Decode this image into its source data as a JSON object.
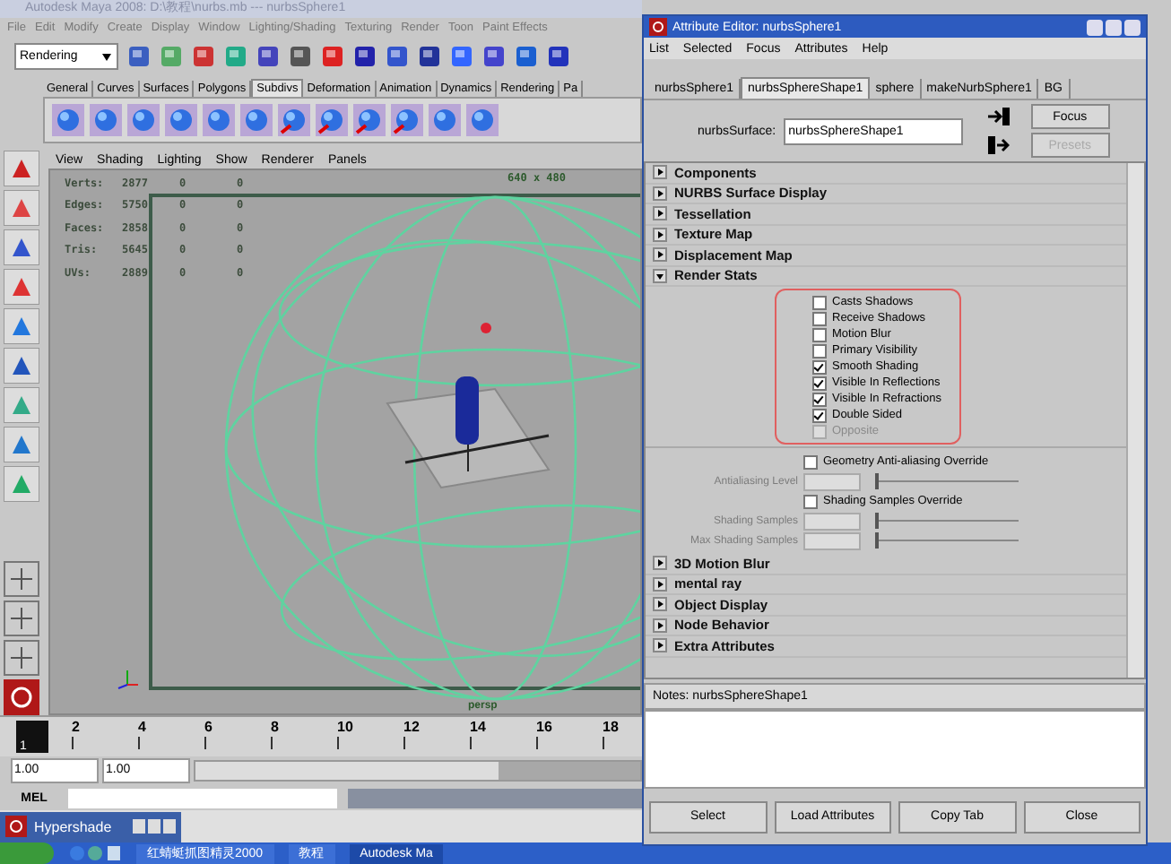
{
  "main_window": {
    "title": "Autodesk Maya 2008: D:\\教程\\nurbs.mb --- nurbsSphere1",
    "menu": [
      "File",
      "Edit",
      "Modify",
      "Create",
      "Display",
      "Window",
      "Lighting/Shading",
      "Texturing",
      "Render",
      "Toon",
      "Paint Effects"
    ],
    "menu_set": "Rendering",
    "shelf_tabs": [
      {
        "label": "General",
        "selected": false
      },
      {
        "label": "Curves",
        "selected": false
      },
      {
        "label": "Surfaces",
        "selected": false
      },
      {
        "label": "Polygons",
        "selected": false
      },
      {
        "label": "Subdivs",
        "selected": true
      },
      {
        "label": "Deformation",
        "selected": false
      },
      {
        "label": "Animation",
        "selected": false
      },
      {
        "label": "Dynamics",
        "selected": false
      },
      {
        "label": "Rendering",
        "selected": false
      },
      {
        "label": "Pa",
        "selected": false
      }
    ],
    "panel_menu": [
      "View",
      "Shading",
      "Lighting",
      "Show",
      "Renderer",
      "Panels"
    ],
    "hud": [
      {
        "label": "Verts:",
        "values": [
          "2877",
          "0",
          "0"
        ]
      },
      {
        "label": "Edges:",
        "values": [
          "5750",
          "0",
          "0"
        ]
      },
      {
        "label": "Faces:",
        "values": [
          "2858",
          "0",
          "0"
        ]
      },
      {
        "label": "Tris:",
        "values": [
          "5645",
          "0",
          "0"
        ]
      },
      {
        "label": "UVs:",
        "values": [
          "2889",
          "0",
          "0"
        ]
      }
    ],
    "resolution": "640 x 480",
    "camera": "persp",
    "timeline": {
      "current": "1",
      "level": 0,
      "ticks": [
        "2",
        "4",
        "6",
        "8",
        "10",
        "12",
        "14",
        "16",
        "18"
      ]
    },
    "range": {
      "fields": [
        "1.00",
        "1.00"
      ],
      "level": 0.68
    },
    "command_line": {
      "label": "MEL"
    },
    "minimized_window": {
      "title": "Hypershade"
    }
  },
  "taskbar": {
    "items": [
      "红蜻蜓抓图精灵2000",
      "教程",
      "Autodesk Ma"
    ]
  },
  "attribute_editor": {
    "title": "Attribute Editor: nurbsSphere1",
    "menu": [
      "List",
      "Selected",
      "Focus",
      "Attributes",
      "Help"
    ],
    "tabs": [
      {
        "label": "nurbsSphere1",
        "selected": false
      },
      {
        "label": "nurbsSphereShape1",
        "selected": true
      },
      {
        "label": "sphere",
        "selected": false
      },
      {
        "label": "makeNurbSphere1",
        "selected": false
      },
      {
        "label": "BG",
        "selected": false
      }
    ],
    "node_label": "nurbsSurface:",
    "node_value": "nurbsSphereShape1",
    "focus_button": "Focus",
    "presets_button": "Presets",
    "sections": [
      {
        "title": "Components",
        "expanded": false
      },
      {
        "title": "NURBS Surface Display",
        "expanded": false
      },
      {
        "title": "Tessellation",
        "expanded": false
      },
      {
        "title": "Texture Map",
        "expanded": false
      },
      {
        "title": "Displacement Map",
        "expanded": false
      },
      {
        "title": "Render Stats",
        "expanded": true,
        "options": [
          {
            "label": "Casts Shadows",
            "checked": false,
            "disabled": false
          },
          {
            "label": "Receive Shadows",
            "checked": false,
            "disabled": false
          },
          {
            "label": "Motion Blur",
            "checked": false,
            "disabled": false
          },
          {
            "label": "Primary Visibility",
            "checked": false,
            "disabled": false
          },
          {
            "label": "Smooth Shading",
            "checked": true,
            "disabled": false
          },
          {
            "label": "Visible In Reflections",
            "checked": true,
            "disabled": false
          },
          {
            "label": "Visible In Refractions",
            "checked": true,
            "disabled": false
          },
          {
            "label": "Double Sided",
            "checked": true,
            "disabled": false
          },
          {
            "label": "Opposite",
            "checked": false,
            "disabled": true
          }
        ],
        "extra": [
          {
            "kind": "checkbox",
            "label": "Geometry Anti-aliasing Override",
            "checked": false
          },
          {
            "kind": "slider",
            "label": "Antialiasing Level",
            "level": 0,
            "disabled": true
          },
          {
            "kind": "checkbox",
            "label": "Shading Samples Override",
            "checked": false
          },
          {
            "kind": "slider",
            "label": "Shading Samples",
            "level": 0,
            "disabled": true
          },
          {
            "kind": "slider",
            "label": "Max Shading Samples",
            "level": 0,
            "disabled": true
          }
        ]
      },
      {
        "title": "3D Motion Blur",
        "expanded": false
      },
      {
        "title": "mental ray",
        "expanded": false
      },
      {
        "title": "Object Display",
        "expanded": false
      },
      {
        "title": "Node Behavior",
        "expanded": false
      },
      {
        "title": "Extra Attributes",
        "expanded": false
      }
    ],
    "notes_label": "Notes:  nurbsSphereShape1",
    "buttons": [
      "Select",
      "Load Attributes",
      "Copy Tab",
      "Close"
    ]
  }
}
